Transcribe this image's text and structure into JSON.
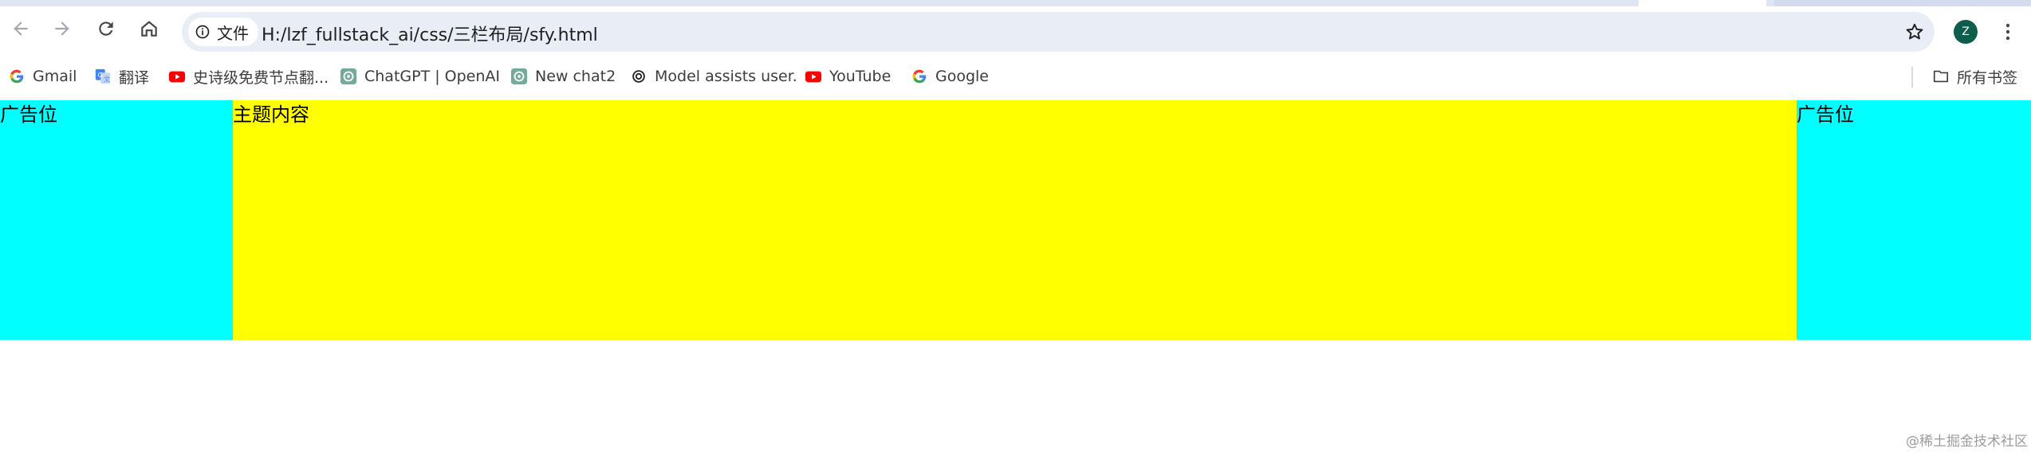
{
  "browser": {
    "address": {
      "security_chip_label": "文件",
      "url": "H:/lzf_fullstack_ai/css/三栏布局/sfy.html"
    },
    "profile_initial": "Z",
    "icons": {
      "back": "back-arrow-icon",
      "forward": "forward-arrow-icon",
      "reload": "reload-icon",
      "home": "home-icon",
      "info": "info-icon",
      "star": "star-icon",
      "menu": "kebab-menu-icon"
    }
  },
  "bookmarks": {
    "items": [
      {
        "label": "Gmail",
        "icon": "google-g-icon"
      },
      {
        "label": "翻译",
        "icon": "google-translate-icon"
      },
      {
        "label": "史诗级免费节点翻...",
        "icon": "youtube-icon"
      },
      {
        "label": "ChatGPT | OpenAI",
        "icon": "chatgpt-icon"
      },
      {
        "label": "New chat2",
        "icon": "chatgpt-icon"
      },
      {
        "label": "Model assists user.",
        "icon": "openai-icon"
      },
      {
        "label": "YouTube",
        "icon": "youtube-icon"
      },
      {
        "label": "Google",
        "icon": "google-g-icon"
      }
    ],
    "all_bookmarks_label": "所有书签"
  },
  "page": {
    "left_column_text": "广告位",
    "main_column_text": "主题内容",
    "right_column_text": "广告位",
    "colors": {
      "side_columns": "#00ffff",
      "main_column": "#ffff00"
    },
    "watermark": "@稀土掘金技术社区"
  }
}
